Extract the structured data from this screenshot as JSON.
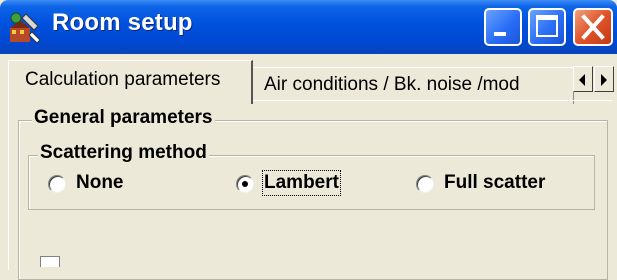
{
  "window": {
    "title": "Room setup",
    "icon": "room-setup-app-icon",
    "controls": {
      "minimize_icon": "minimize-icon",
      "maximize_icon": "maximize-icon",
      "close_icon": "close-icon"
    }
  },
  "tabs": [
    {
      "label": "Calculation parameters",
      "active": true
    },
    {
      "label": "Air conditions / Bk. noise /mod",
      "active": false
    }
  ],
  "tab_scroll": {
    "left_icon": "scroll-left-icon",
    "right_icon": "scroll-right-icon"
  },
  "general_parameters": {
    "legend": "General parameters",
    "scattering_method": {
      "legend": "Scattering method",
      "options": [
        {
          "label": "None",
          "selected": false
        },
        {
          "label": "Lambert",
          "selected": true
        },
        {
          "label": "Full scatter",
          "selected": false
        }
      ]
    }
  },
  "colors": {
    "titlebar": "#0050de",
    "dialog_face": "#ece9d8",
    "close_button": "#e0542a"
  }
}
